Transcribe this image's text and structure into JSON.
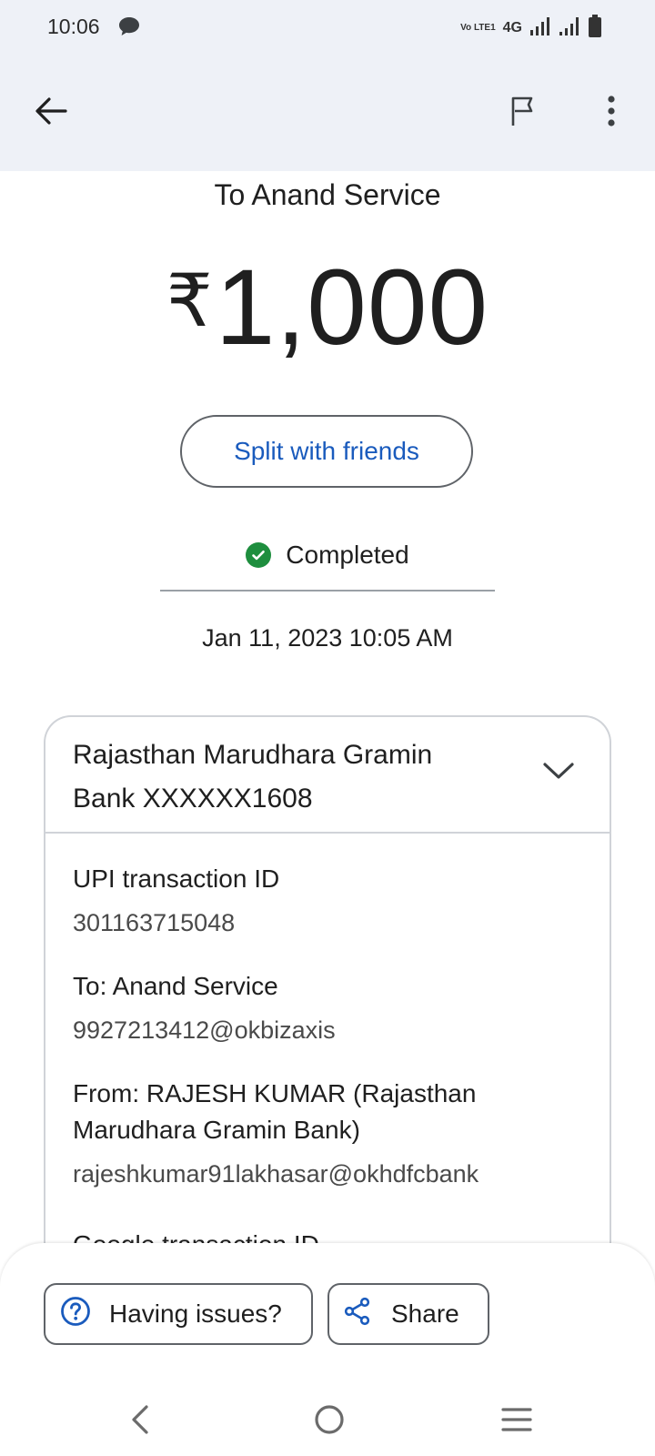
{
  "status_bar": {
    "time": "10:06",
    "volte": "Vo LTE1",
    "network": "4G",
    "icons": [
      "message-icon",
      "signal-icon",
      "signal-icon-2",
      "battery-icon"
    ]
  },
  "app_bar": {
    "icons": [
      "back-arrow-icon",
      "flag-icon",
      "more-vert-icon"
    ]
  },
  "transaction": {
    "recipient_title": "To Anand Service",
    "currency_symbol": "₹",
    "amount": "1,000",
    "split_label": "Split with friends",
    "status": "Completed",
    "datetime": "Jan 11, 2023 10:05 AM"
  },
  "details": {
    "bank_account": "Rajasthan Marudhara Gramin Bank XXXXXX1608",
    "upi_label": "UPI transaction ID",
    "upi_value": "301163715048",
    "to_label": "To: Anand Service",
    "to_value": "9927213412@okbizaxis",
    "from_label": "From: RAJESH KUMAR (Rajasthan Marudhara Gramin Bank)",
    "from_value": "rajeshkumar91lakhasar@okhdfcbank",
    "google_label": "Google transaction ID"
  },
  "actions": {
    "issues_label": "Having issues?",
    "share_label": "Share"
  },
  "colors": {
    "accent": "#1a5bbd",
    "success": "#1e8e3e",
    "topbar_bg": "#eef1f7"
  }
}
